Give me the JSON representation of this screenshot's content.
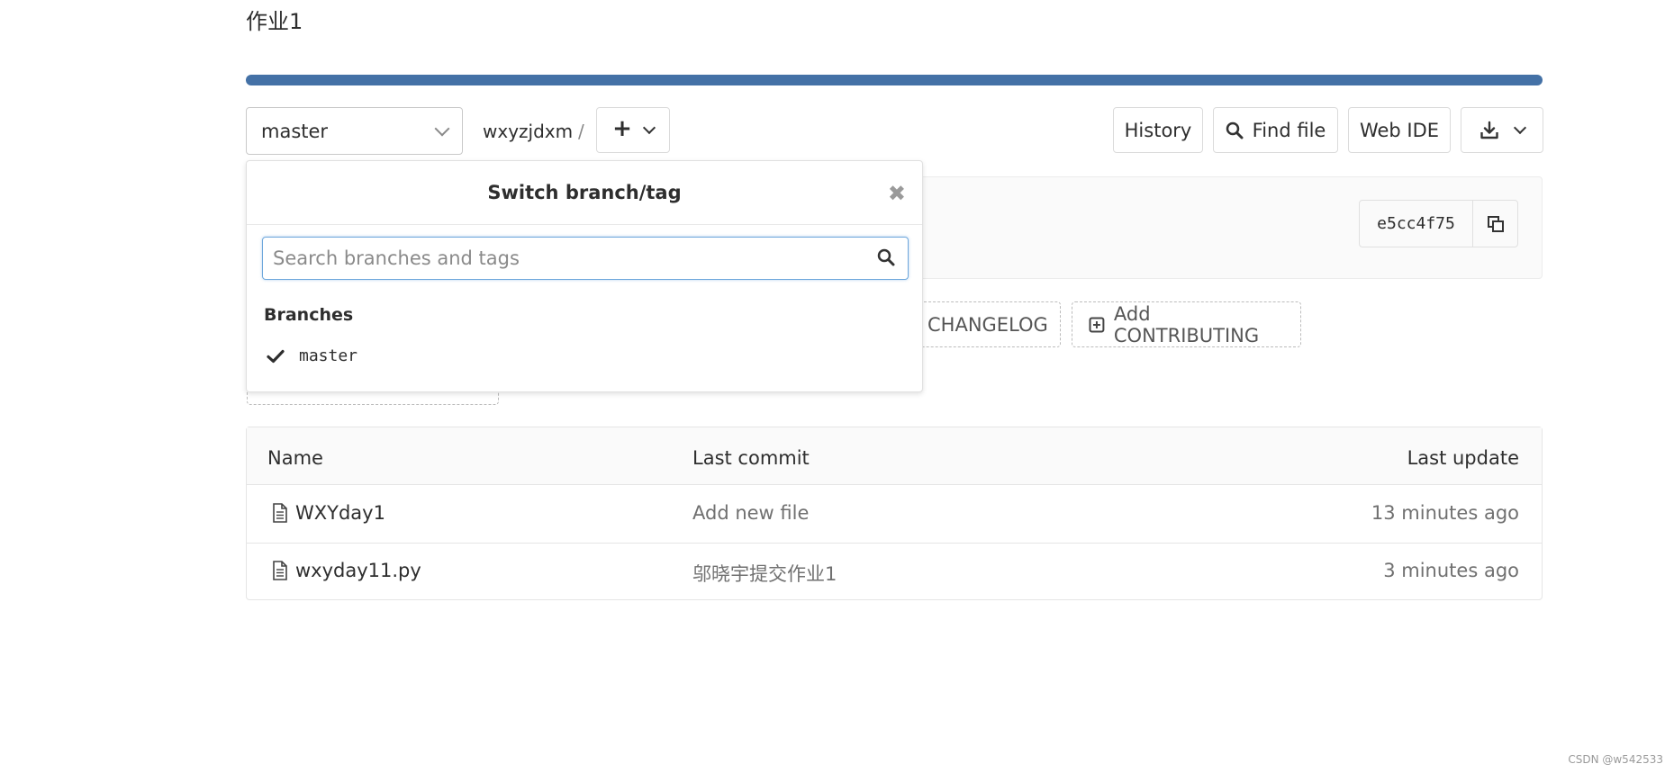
{
  "project": {
    "title": "作业1"
  },
  "toolbar": {
    "branch_selected": "master",
    "project_name": "wxyzjdxm",
    "path_separator": "/",
    "add_label": "+",
    "history_label": "History",
    "find_file_label": "Find file",
    "web_ide_label": "Web IDE"
  },
  "commit": {
    "sha": "e5cc4f75"
  },
  "quick_actions": {
    "changelog_label": "d CHANGELOG",
    "contributing_label": "Add CONTRIBUTING"
  },
  "branch_dropdown": {
    "title": "Switch branch/tag",
    "close_symbol": "✖",
    "search_placeholder": "Search branches and tags",
    "section_label": "Branches",
    "items": [
      {
        "label": "master",
        "selected": true
      }
    ]
  },
  "file_table": {
    "headers": {
      "name": "Name",
      "last_commit": "Last commit",
      "last_update": "Last update"
    },
    "rows": [
      {
        "name": "WXYday1",
        "commit": "Add new file",
        "updated": "13 minutes ago"
      },
      {
        "name": "wxyday11.py",
        "commit": "邬晓宇提交作业1",
        "updated": "3 minutes ago"
      }
    ]
  },
  "watermark": "CSDN @w542533",
  "colors": {
    "accent": "#4471a6",
    "focus": "#6ea7dc"
  }
}
